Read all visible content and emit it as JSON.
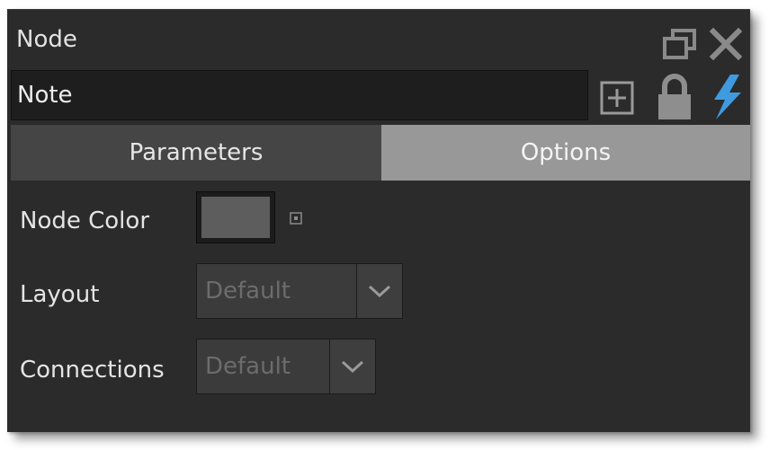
{
  "panel": {
    "title": "Node",
    "name_value": "Note",
    "icons": {
      "restore": "restore-window-icon",
      "close": "close-icon",
      "add": "add-icon",
      "lock": "lock-icon",
      "bolt": "lightning-bolt-icon",
      "reset": "reset-dot-icon",
      "dropdown": "chevron-down-icon"
    },
    "accent_color": "#3f9be0"
  },
  "tabs": [
    {
      "label": "Parameters",
      "active": false
    },
    {
      "label": "Options",
      "active": true
    }
  ],
  "options": {
    "node_color": {
      "label": "Node Color",
      "value_color": "#5d5d5d"
    },
    "layout": {
      "label": "Layout",
      "value": "Default"
    },
    "connections": {
      "label": "Connections",
      "value": "Default"
    }
  }
}
